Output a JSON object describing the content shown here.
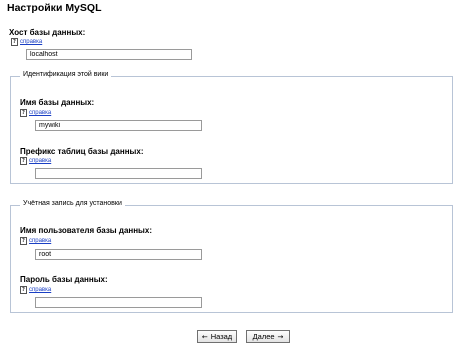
{
  "page": {
    "title": "Настройки MySQL"
  },
  "help": {
    "icon_glyph": "?",
    "link_label": "справка"
  },
  "db_host": {
    "label": "Хост базы данных:",
    "value": "localhost"
  },
  "wiki_identification": {
    "legend": "Идентификация этой вики",
    "db_name": {
      "label": "Имя базы данных:",
      "value": "mywiki"
    },
    "table_prefix": {
      "label": "Префикс таблиц базы данных:",
      "value": ""
    }
  },
  "install_account": {
    "legend": "Учётная запись для установки",
    "db_user": {
      "label": "Имя пользователя базы данных:",
      "value": "root"
    },
    "db_password": {
      "label": "Пароль базы данных:",
      "value": ""
    }
  },
  "buttons": {
    "back_arrow": "←",
    "back_label": "Назад",
    "next_label": "Далее",
    "next_arrow": "→"
  },
  "colors": {
    "link": "#1a3fc4",
    "fieldset_border": "#b8c4d6",
    "input_border": "#9a9a9a"
  }
}
